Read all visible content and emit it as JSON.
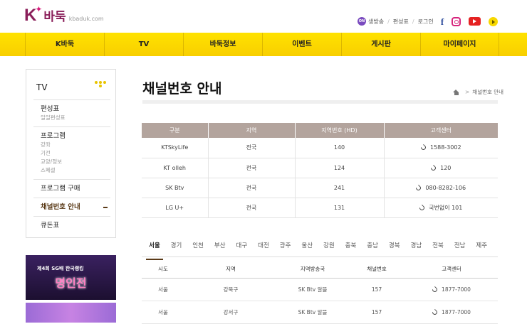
{
  "brand": {
    "logo_k": "K",
    "logo_name": "바둑",
    "url": "kbaduk.com"
  },
  "topmenu": {
    "on_badge": "ON",
    "live": "생방송",
    "schedule": "편성표",
    "login": "로그인"
  },
  "social": [
    "facebook-icon",
    "instagram-icon",
    "youtube-icon",
    "kakaotv-icon"
  ],
  "nav": [
    "K바둑",
    "TV",
    "바둑정보",
    "이벤트",
    "게시판",
    "마이페이지"
  ],
  "sidebar": {
    "title": "TV",
    "groups": [
      {
        "label": "편성표",
        "subs": [
          "일일편성표"
        ]
      },
      {
        "label": "프로그램",
        "subs": [
          "강좌",
          "기전",
          "교양/정보",
          "스페셜"
        ]
      },
      {
        "label": "프로그램 구매",
        "subs": []
      },
      {
        "label": "채널번호 안내",
        "subs": [],
        "active": true
      },
      {
        "label": "큐돈표",
        "subs": []
      }
    ]
  },
  "banner1": {
    "small": "제4회 SG배 한국랭킹",
    "big": "명인전"
  },
  "page": {
    "title": "채널번호 안내",
    "breadcrumb": "채널번호 안내"
  },
  "channel_table": {
    "headers": [
      "구분",
      "지역",
      "지역번호 (HD)",
      "고객센터"
    ],
    "rows": [
      [
        "KTSkyLife",
        "전국",
        "140",
        "1588-3002"
      ],
      [
        "KT olleh",
        "전국",
        "124",
        "120"
      ],
      [
        "SK Btv",
        "전국",
        "241",
        "080-8282-106"
      ],
      [
        "LG U+",
        "전국",
        "131",
        "국번없이 101"
      ]
    ]
  },
  "regions": [
    "서울",
    "경기",
    "인천",
    "부산",
    "대구",
    "대전",
    "광주",
    "울산",
    "강원",
    "충북",
    "충남",
    "경북",
    "경남",
    "전북",
    "전남",
    "제주"
  ],
  "local_table": {
    "headers": [
      "시도",
      "지역",
      "지역방송국",
      "채널번호",
      "고객센터"
    ],
    "rows": [
      [
        "서울",
        "강북구",
        "SK Btv 알뜰",
        "157",
        "1877-7000"
      ],
      [
        "서울",
        "강서구",
        "SK Btv 알뜰",
        "157",
        "1877-7000"
      ]
    ]
  }
}
